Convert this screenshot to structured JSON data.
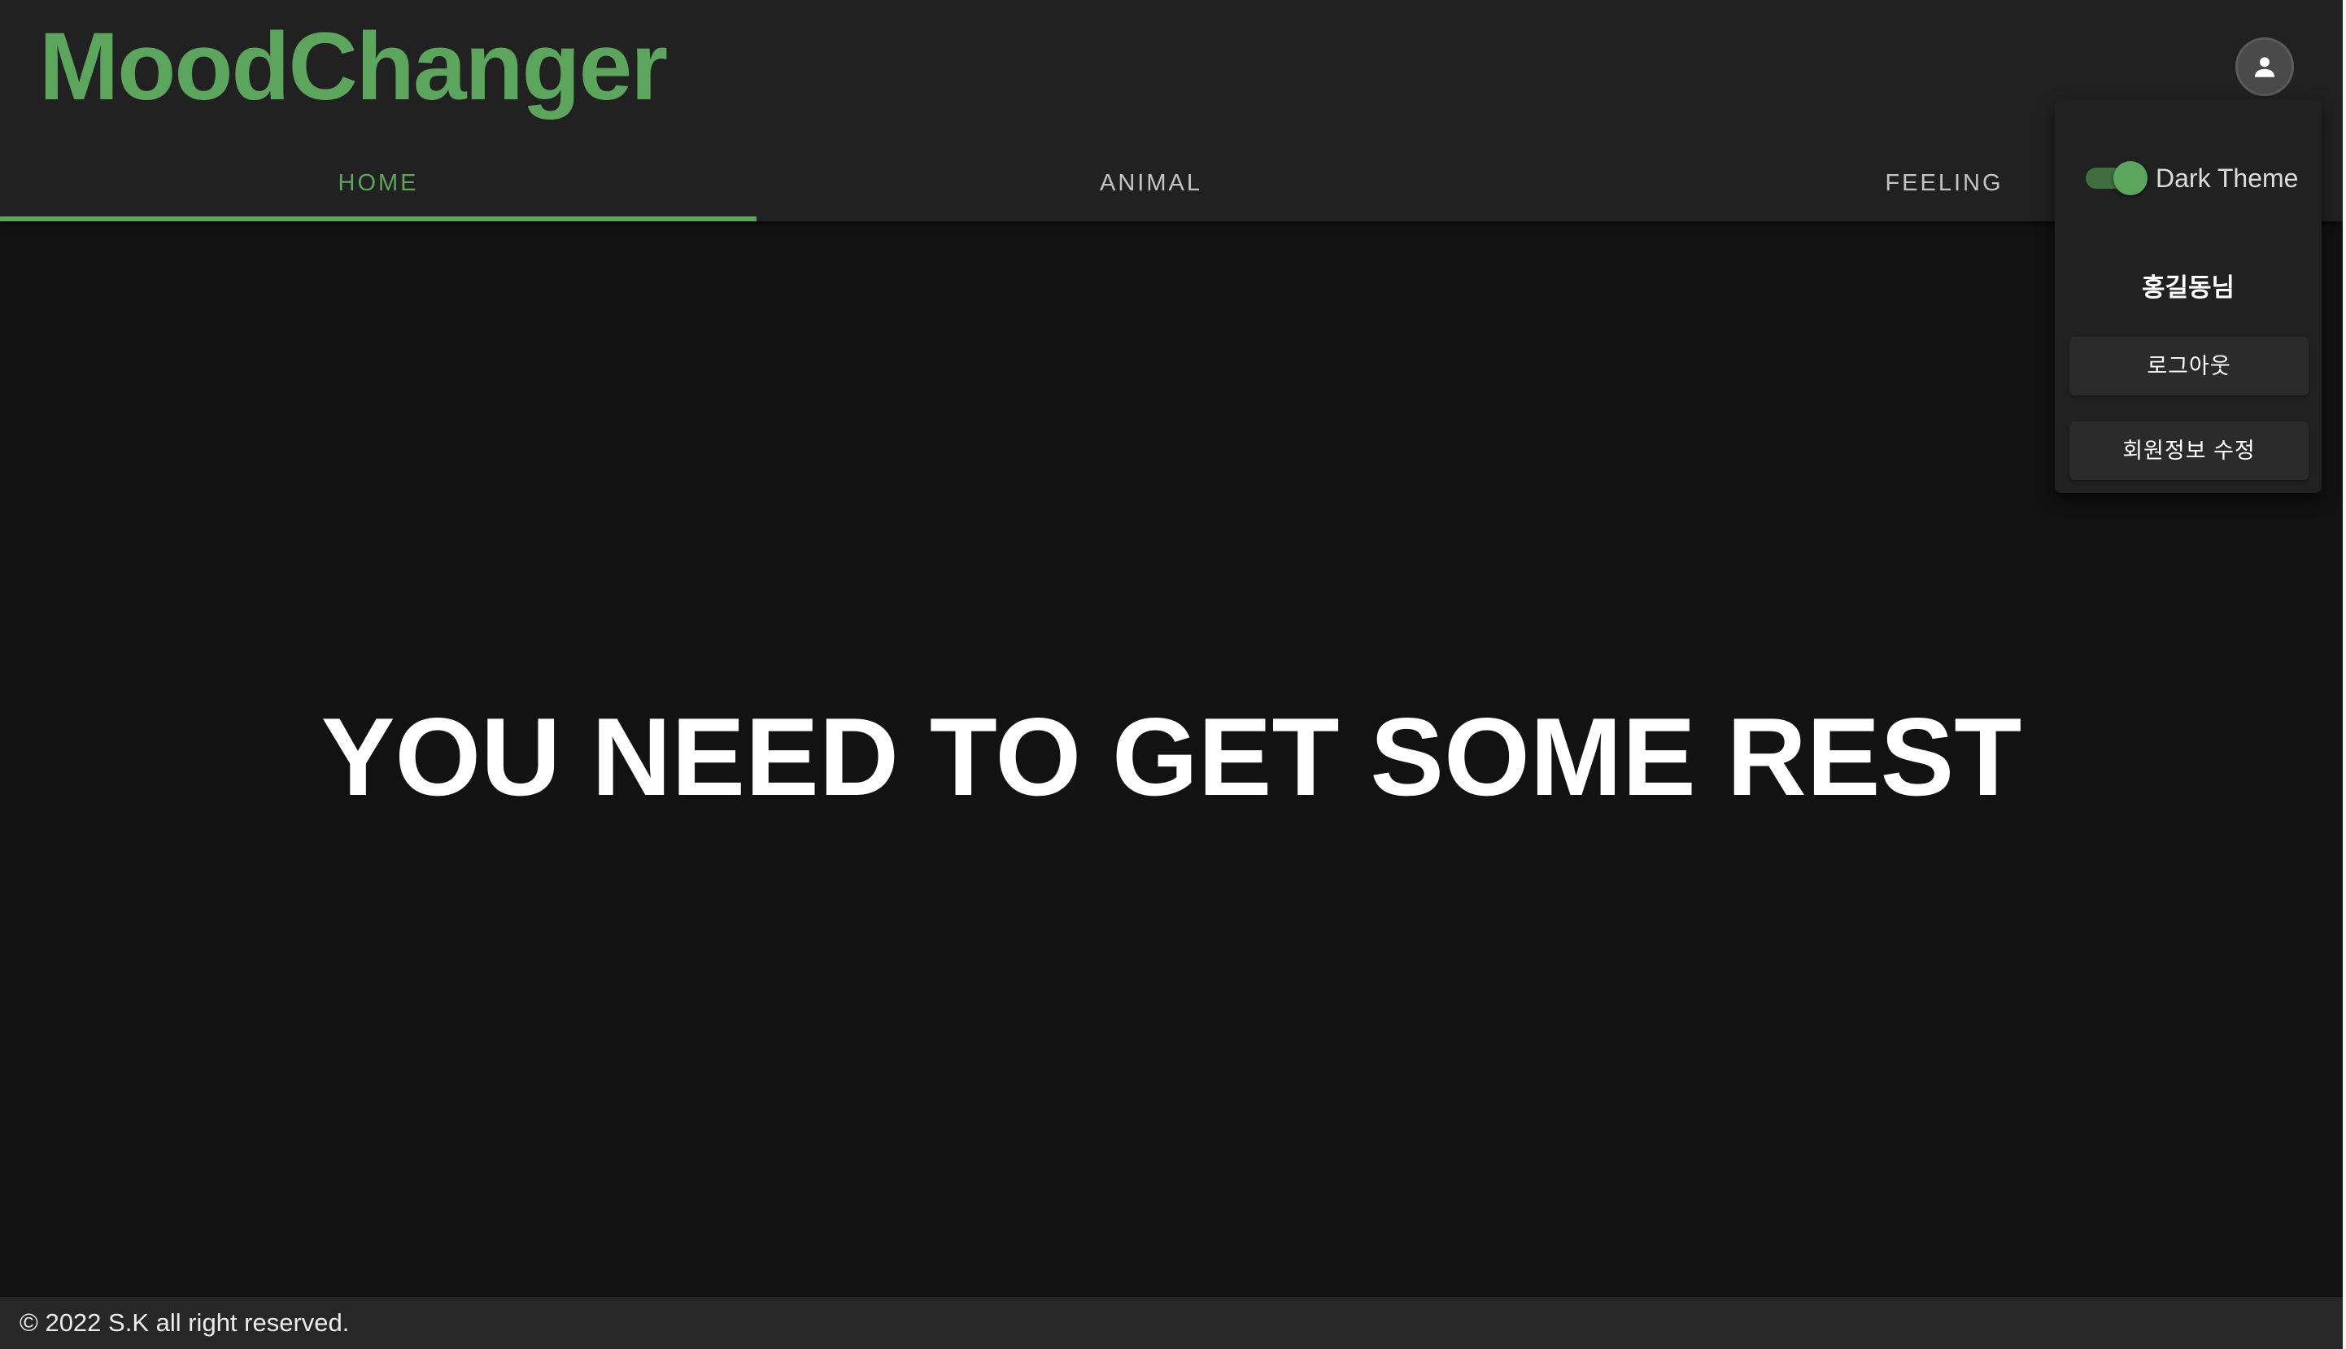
{
  "app": {
    "title": "MoodChanger",
    "accent_color": "#5ca55c",
    "background_color": "#121212"
  },
  "header": {
    "avatar_icon": "account-circle-icon"
  },
  "tabs": [
    {
      "label": "HOME",
      "active": true
    },
    {
      "label": "ANIMAL",
      "active": false
    },
    {
      "label": "FEELING",
      "active": false
    }
  ],
  "main": {
    "message": "YOU NEED TO GET SOME REST"
  },
  "user_menu": {
    "theme_toggle": {
      "label": "Dark Theme",
      "on": true
    },
    "user_name": "홍길동님",
    "logout_label": "로그아웃",
    "edit_profile_label": "회원정보 수정"
  },
  "footer": {
    "copyright": "© 2022 S.K all right reserved."
  }
}
